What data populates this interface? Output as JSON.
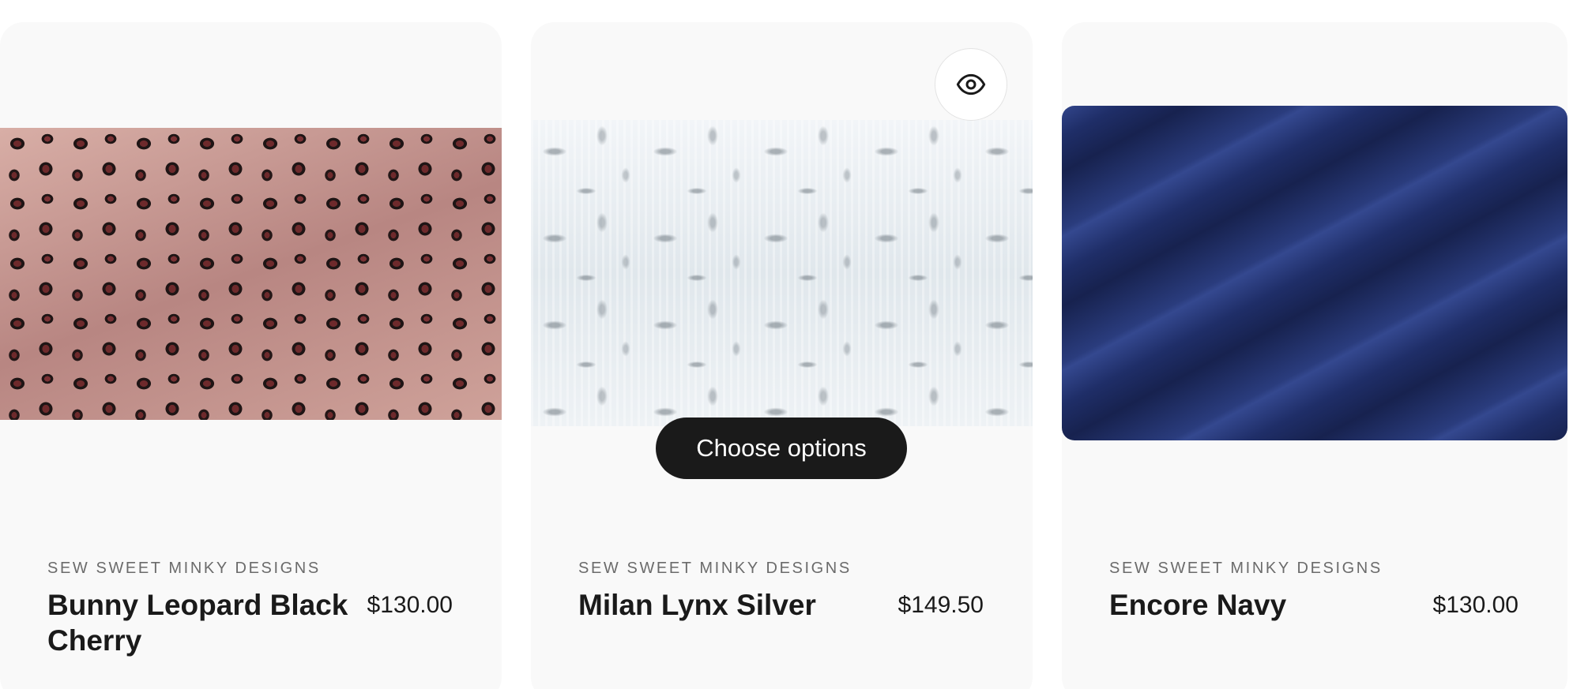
{
  "products": [
    {
      "vendor": "SEW SWEET MINKY DESIGNS",
      "title": "Bunny Leopard Black Cherry",
      "price": "$130.00"
    },
    {
      "vendor": "SEW SWEET MINKY DESIGNS",
      "title": "Milan Lynx Silver",
      "price": "$149.50",
      "choose_options_label": "Choose options",
      "quick_view_icon": "eye-icon"
    },
    {
      "vendor": "SEW SWEET MINKY DESIGNS",
      "title": "Encore Navy",
      "price": "$130.00"
    }
  ],
  "colors": {
    "card_background": "#f9f9f9",
    "button_background": "#1a1a1a",
    "button_text": "#ffffff",
    "vendor_text": "#6b6b6b",
    "title_text": "#1a1a1a"
  }
}
